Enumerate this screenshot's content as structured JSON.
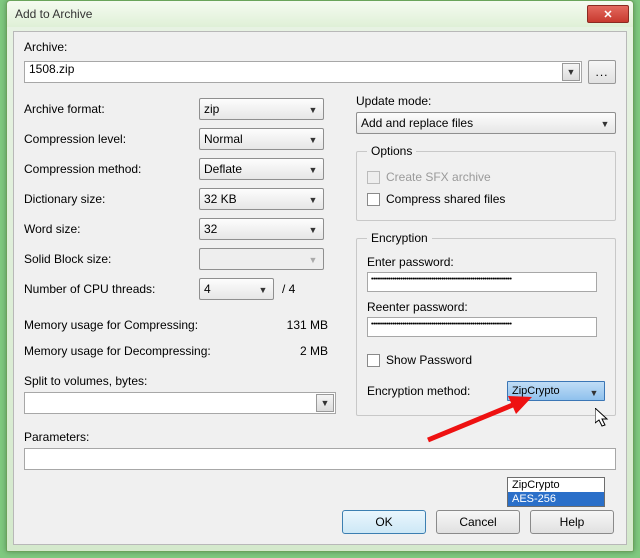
{
  "title": "Add to Archive",
  "archive": {
    "label": "Archive:",
    "value": "1508.zip",
    "browse_label": "..."
  },
  "left": {
    "format": {
      "label": "Archive format:",
      "value": "zip"
    },
    "level": {
      "label": "Compression level:",
      "value": "Normal"
    },
    "method": {
      "label": "Compression method:",
      "value": "Deflate"
    },
    "dict": {
      "label": "Dictionary size:",
      "value": "32 KB"
    },
    "word": {
      "label": "Word size:",
      "value": "32"
    },
    "block": {
      "label": "Solid Block size:",
      "value": ""
    },
    "threads": {
      "label": "Number of CPU threads:",
      "value": "4",
      "suffix": " / 4"
    },
    "mem_compress": {
      "label": "Memory usage for Compressing:",
      "value": "131 MB"
    },
    "mem_decompress": {
      "label": "Memory usage for Decompressing:",
      "value": "2 MB"
    },
    "split": {
      "label": "Split to volumes, bytes:",
      "value": ""
    }
  },
  "right": {
    "update": {
      "label": "Update mode:",
      "value": "Add and replace files"
    },
    "options": {
      "legend": "Options",
      "sfx": "Create SFX archive",
      "shared": "Compress shared files"
    },
    "encryption": {
      "legend": "Encryption",
      "enter_label": "Enter password:",
      "reenter_label": "Reenter password:",
      "mask": "••••••••••••••••••••••••••••••••••••••••••••••••••••••••••••••••••••••••",
      "show_label": "Show Password",
      "method_label": "Encryption method:",
      "method_value": "ZipCrypto",
      "options": {
        "0": "ZipCrypto",
        "1": "AES-256"
      }
    }
  },
  "parameters": {
    "label": "Parameters:",
    "value": ""
  },
  "buttons": {
    "ok": "OK",
    "cancel": "Cancel",
    "help": "Help"
  }
}
